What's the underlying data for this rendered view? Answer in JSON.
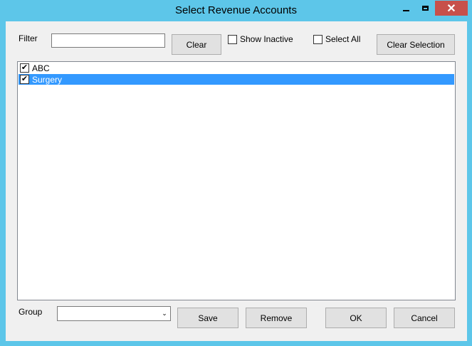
{
  "window": {
    "title": "Select Revenue Accounts",
    "close_glyph": "✕"
  },
  "filter": {
    "label": "Filter",
    "value": "",
    "clear_label": "Clear"
  },
  "options": {
    "show_inactive_label": "Show Inactive",
    "show_inactive_checked": false,
    "select_all_label": "Select All",
    "select_all_checked": false,
    "clear_selection_label": "Clear Selection"
  },
  "accounts": [
    {
      "label": "ABC",
      "checked": true,
      "selected": false,
      "check_glyph": "✔"
    },
    {
      "label": "Surgery",
      "checked": true,
      "selected": true,
      "check_glyph": "✔"
    }
  ],
  "group": {
    "label": "Group",
    "value": "",
    "arrow_glyph": "⌄"
  },
  "buttons": {
    "save": "Save",
    "remove": "Remove",
    "ok": "OK",
    "cancel": "Cancel"
  },
  "colors": {
    "title_bar": "#5dc6e9",
    "selection": "#3399ff",
    "close_button": "#c7504a"
  }
}
